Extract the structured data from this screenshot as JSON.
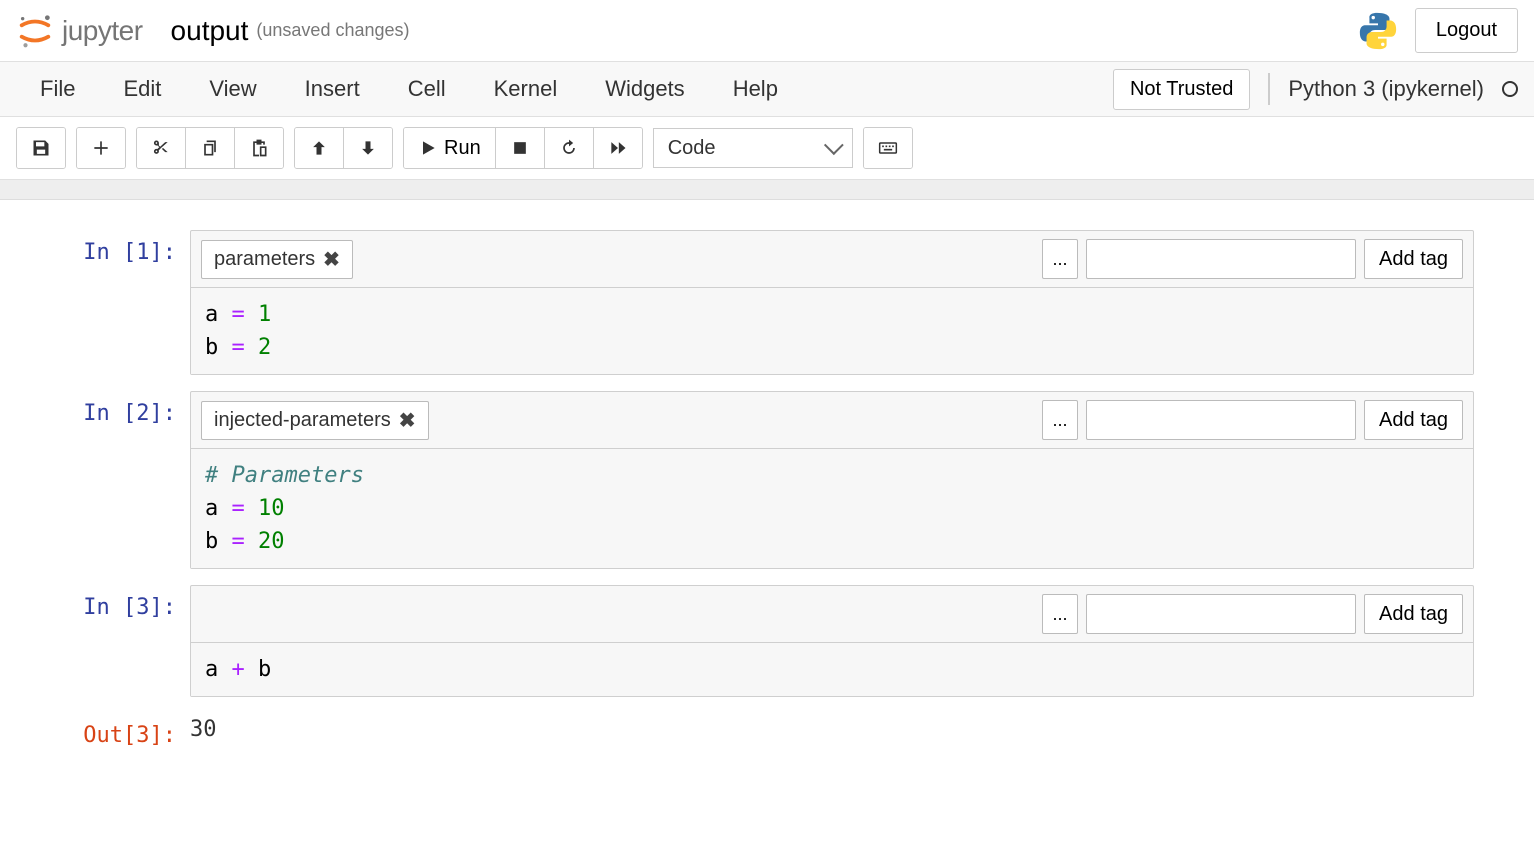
{
  "header": {
    "brand": "jupyter",
    "title": "output",
    "unsaved": "(unsaved changes)",
    "logout_label": "Logout"
  },
  "menubar": {
    "items": [
      "File",
      "Edit",
      "View",
      "Insert",
      "Cell",
      "Kernel",
      "Widgets",
      "Help"
    ],
    "trust_label": "Not Trusted",
    "kernel_name": "Python 3 (ipykernel)"
  },
  "toolbar": {
    "run_label": "Run",
    "celltype": "Code"
  },
  "tag_ui": {
    "more_label": "...",
    "add_tag_label": "Add tag"
  },
  "cells": {
    "0": {
      "prompt": "In [1]:",
      "tags": [
        "parameters"
      ],
      "code_tokens": [
        [
          {
            "t": "a ",
            "c": "var"
          },
          {
            "t": "=",
            "c": "op"
          },
          {
            "t": " ",
            "c": "var"
          },
          {
            "t": "1",
            "c": "num"
          }
        ],
        [
          {
            "t": "b ",
            "c": "var"
          },
          {
            "t": "=",
            "c": "op"
          },
          {
            "t": " ",
            "c": "var"
          },
          {
            "t": "2",
            "c": "num"
          }
        ]
      ]
    },
    "1": {
      "prompt": "In [2]:",
      "tags": [
        "injected-parameters"
      ],
      "code_tokens": [
        [
          {
            "t": "# Parameters",
            "c": "comment"
          }
        ],
        [
          {
            "t": "a ",
            "c": "var"
          },
          {
            "t": "=",
            "c": "op"
          },
          {
            "t": " ",
            "c": "var"
          },
          {
            "t": "10",
            "c": "num"
          }
        ],
        [
          {
            "t": "b ",
            "c": "var"
          },
          {
            "t": "=",
            "c": "op"
          },
          {
            "t": " ",
            "c": "var"
          },
          {
            "t": "20",
            "c": "num"
          }
        ]
      ]
    },
    "2": {
      "prompt": "In [3]:",
      "tags": [],
      "code_tokens": [
        [
          {
            "t": "a ",
            "c": "var"
          },
          {
            "t": "+",
            "c": "op"
          },
          {
            "t": " b",
            "c": "var"
          }
        ]
      ],
      "out_prompt": "Out[3]:",
      "out_text": "30"
    }
  }
}
